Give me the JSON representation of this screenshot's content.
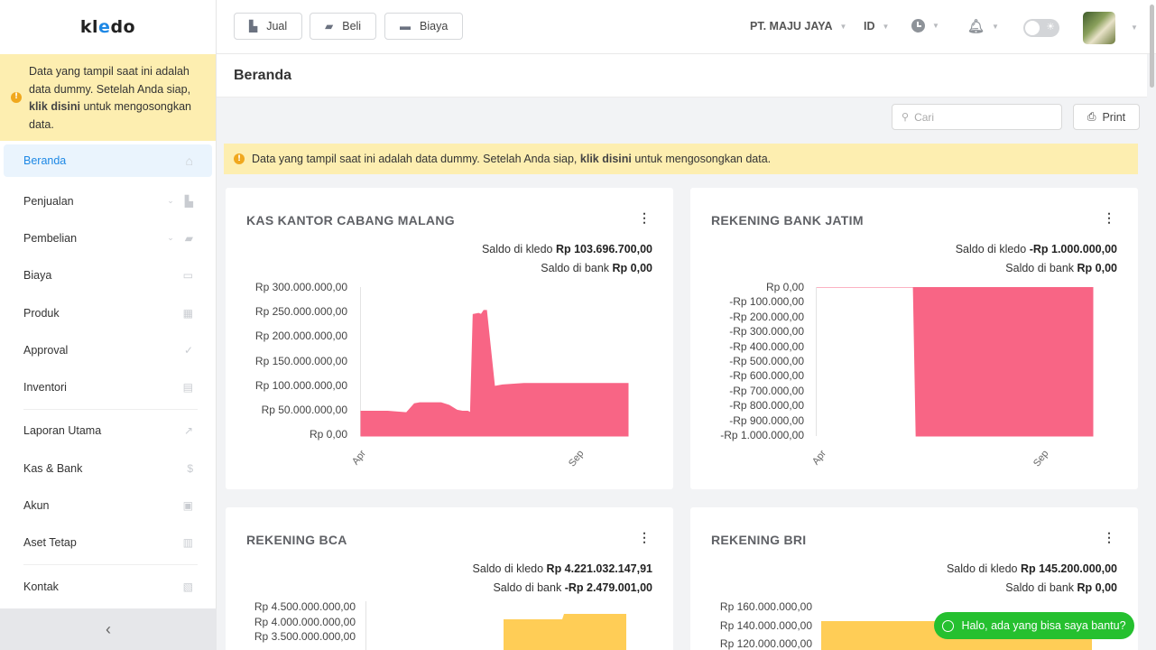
{
  "app": {
    "logo_pre": "kl",
    "logo_mid": "e",
    "logo_post": "do"
  },
  "sidebar": {
    "notice": {
      "text1": "Data yang tampil saat ini adalah data dummy. Setelah Anda siap, ",
      "link": "klik disini",
      "text2": " untuk mengosongkan data."
    },
    "items": [
      {
        "label": "Beranda",
        "icon": "home-icon",
        "glyph": "⌂"
      },
      {
        "label": "Penjualan",
        "icon": "basket-icon",
        "glyph": "🧺"
      },
      {
        "label": "Pembelian",
        "icon": "bag-icon",
        "glyph": "▰"
      },
      {
        "label": "Biaya",
        "icon": "card-icon",
        "glyph": "▭"
      },
      {
        "label": "Produk",
        "icon": "boxes-icon",
        "glyph": "▦"
      },
      {
        "label": "Approval",
        "icon": "check-icon",
        "glyph": "✓"
      },
      {
        "label": "Inventori",
        "icon": "warehouse-icon",
        "glyph": "▤"
      },
      {
        "label": "Laporan Utama",
        "icon": "chart-icon",
        "glyph": "↗"
      },
      {
        "label": "Kas & Bank",
        "icon": "dollar-icon",
        "glyph": "$"
      },
      {
        "label": "Akun",
        "icon": "ledger-icon",
        "glyph": "▣"
      },
      {
        "label": "Aset Tetap",
        "icon": "building-icon",
        "glyph": "▥"
      },
      {
        "label": "Kontak",
        "icon": "contact-card-icon",
        "glyph": "▧"
      }
    ]
  },
  "topbar": {
    "buttons": [
      {
        "label": "Jual"
      },
      {
        "label": "Beli"
      },
      {
        "label": "Biaya"
      }
    ],
    "company": "PT. MAJU JAYA",
    "language": "ID"
  },
  "page": {
    "title": "Beranda"
  },
  "search": {
    "placeholder": "Cari"
  },
  "print": {
    "label": "Print"
  },
  "main_notice": {
    "text1": "Data yang tampil saat ini adalah data dummy. Setelah Anda siap, ",
    "link": "klik disini",
    "text2": " untuk mengosongkan data."
  },
  "whatsapp": {
    "label": "Halo, ada yang bisa saya bantu?"
  },
  "colors": {
    "pink": "#f86585",
    "yellow": "#ffcd56",
    "accent": "#1d88e5",
    "notice": "#fdeeb0"
  },
  "cards": [
    {
      "title": "KAS KANTOR CABANG MALANG",
      "saldo_kledo_label": "Saldo di kledo",
      "saldo_kledo_value": "Rp 103.696.700,00",
      "saldo_bank_label": "Saldo di bank",
      "saldo_bank_value": "Rp 0,00"
    },
    {
      "title": "REKENING BANK JATIM",
      "saldo_kledo_label": "Saldo di kledo",
      "saldo_kledo_value": "-Rp 1.000.000,00",
      "saldo_bank_label": "Saldo di bank",
      "saldo_bank_value": "Rp 0,00"
    },
    {
      "title": "REKENING BCA",
      "saldo_kledo_label": "Saldo di kledo",
      "saldo_kledo_value": "Rp 4.221.032.147,91",
      "saldo_bank_label": "Saldo di bank",
      "saldo_bank_value": "-Rp 2.479.001,00"
    },
    {
      "title": "REKENING BRI",
      "saldo_kledo_label": "Saldo di kledo",
      "saldo_kledo_value": "Rp 145.200.000,00",
      "saldo_bank_label": "Saldo di bank",
      "saldo_bank_value": "Rp 0,00"
    }
  ],
  "chart_data": [
    {
      "type": "area",
      "title": "KAS KANTOR CABANG MALANG",
      "color": "#f86585",
      "x": [
        0,
        0.1,
        0.17,
        0.2,
        0.22,
        0.3,
        0.33,
        0.36,
        0.38,
        0.4,
        0.41,
        0.42,
        0.44,
        0.45,
        0.46,
        0.47,
        0.5,
        0.53,
        0.61,
        0.8,
        1.0
      ],
      "values": [
        50000000,
        50000000,
        47000000,
        65000000,
        67000000,
        67000000,
        62000000,
        52000000,
        50000000,
        50000000,
        47000000,
        245000000,
        247000000,
        245000000,
        253000000,
        253000000,
        100000000,
        103000000,
        106000000,
        106000000,
        106000000
      ],
      "ylim": [
        0,
        300000000
      ],
      "yticks": [
        "Rp 300.000.000,00",
        "Rp 250.000.000,00",
        "Rp 200.000.000,00",
        "Rp 150.000.000,00",
        "Rp 100.000.000,00",
        "Rp 50.000.000,00",
        "Rp 0,00"
      ],
      "xticks": [
        "Apr",
        "Sep"
      ]
    },
    {
      "type": "area",
      "title": "REKENING BANK JATIM",
      "color": "#f86585",
      "x": [
        0,
        0.35,
        0.36,
        0.37,
        1.0
      ],
      "values": [
        0,
        0,
        -1000000000,
        -1000000000,
        -1000000000
      ],
      "ylim": [
        -1000000000,
        0
      ],
      "yticks": [
        "Rp 0,00",
        "-Rp 100.000,00",
        "-Rp 200.000,00",
        "-Rp 300.000,00",
        "-Rp 400.000,00",
        "-Rp 500.000,00",
        "-Rp 600.000,00",
        "-Rp 700.000,00",
        "-Rp 800.000,00",
        "-Rp 900.000,00",
        "-Rp 1.000.000,00"
      ],
      "xticks": [
        "Apr",
        "Sep"
      ]
    },
    {
      "type": "area",
      "title": "REKENING BCA",
      "color": "#ffcd56",
      "yticks": [
        "Rp 4.500.000.000,00",
        "Rp 4.000.000.000,00",
        "Rp 3.500.000.000,00"
      ]
    },
    {
      "type": "area",
      "title": "REKENING BRI",
      "color": "#ffcd56",
      "yticks": [
        "Rp 160.000.000,00",
        "Rp 140.000.000,00",
        "Rp 120.000.000,00"
      ]
    }
  ]
}
